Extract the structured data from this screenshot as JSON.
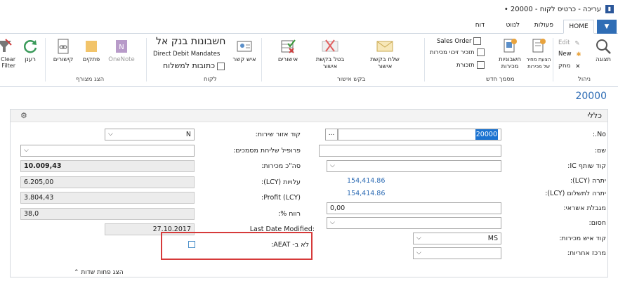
{
  "window": {
    "title": "עריכה - כרטיס לקוח - 20000 •"
  },
  "tabs": {
    "home": "HOME",
    "actions": "פעולות",
    "navigate": "לנווט",
    "report": "דוח"
  },
  "ribbon": {
    "manage": {
      "view": "תצוגה",
      "edit": "Edit",
      "new": "New",
      "delete": "מחק",
      "group": "ניהול"
    },
    "new_document": {
      "new_sales_invoice": "חשבונית מכירות",
      "new_sales_quote": "הצעת מחיר",
      "new_sales_quote_line2": "של מכירות",
      "sales_invoice": "חשבוניות",
      "sales_invoice_line2": "מכירות",
      "sales_order": "Sales Order",
      "credit_memo": "תזכיר זיכוי מכירות",
      "reminder": "תזכורת",
      "group": "מסמך חדש"
    },
    "approval": {
      "send_request": "שלח בקשת",
      "send_request_line2": "אישור",
      "cancel_request": "בטל בקשת",
      "cancel_request_line2": "אישור",
      "approvals": "אישורים",
      "group": "בקש אישור"
    },
    "customer": {
      "contact": "איש קשר",
      "bank_accounts": "חשבונות בנק אל",
      "direct_debit": "Direct Debit Mandates",
      "ship_to": "כתובות למשלוח",
      "group": "לקוח"
    },
    "show_attached": {
      "onenote": "OneNote",
      "notes": "פתקים",
      "links": "קישורים",
      "group": "הצג מצורף"
    },
    "page": {
      "refresh": "רענן",
      "clear_filter": "Clear Filter"
    }
  },
  "page": {
    "title": "20000",
    "section": "כללי",
    "show_more": "הצג פחות שדות"
  },
  "fields": {
    "no_label": "No.:",
    "no_value": "20000",
    "name_label": "שם:",
    "name_value": "",
    "ic_partner_label": "קוד שותף IC:",
    "balance_lcy_label": "יתרה (LCY):",
    "balance_lcy_value": "154,414.86",
    "balance_due_label": "יתרה לתשלום (LCY):",
    "balance_due_value": "154,414.86",
    "credit_limit_label": "מגבלת אשראי:",
    "credit_limit_value": "0,00",
    "blocked_label": "חסום:",
    "salesperson_label": "קוד איש מכירות:",
    "salesperson_value": "MS",
    "resp_center_label": "מרכז אחריות:",
    "service_zone_label": "קוד אזור שירות:",
    "service_zone_value": "N",
    "doc_sending_label": "פרופיל שליחת מסמכים:",
    "total_sales_label": "סה\"כ מכירות:",
    "total_sales_value": "10.009,43",
    "costs_label": "עלויות (LCY):",
    "costs_value": "6.205,00",
    "profit_label": "(Profit (LCY:",
    "profit_value": "3.804,43",
    "profit_pct_label": "רווח %:",
    "profit_pct_value": "38,0",
    "last_modified_label": "Last Date Modified:",
    "last_modified_value": "27.10.2017",
    "aeat_label": "לא ב- AEAT:"
  }
}
